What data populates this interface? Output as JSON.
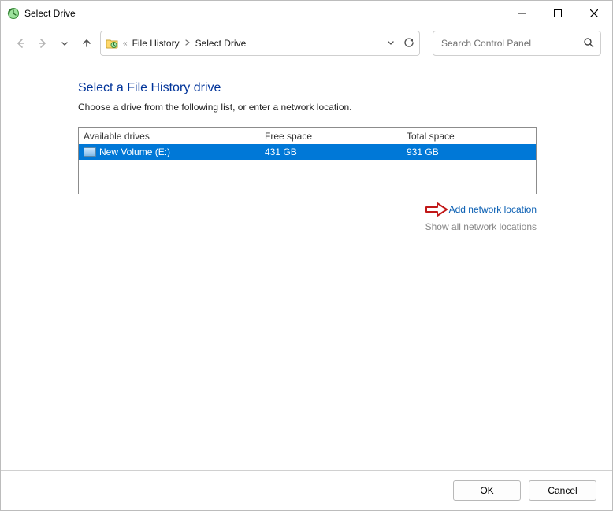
{
  "window": {
    "title": "Select Drive"
  },
  "breadcrumb": {
    "overflow_label": "«",
    "item1": "File History",
    "item2": "Select Drive"
  },
  "search": {
    "placeholder": "Search Control Panel"
  },
  "page": {
    "heading": "Select a File History drive",
    "instruction": "Choose a drive from the following list, or enter a network location."
  },
  "columns": {
    "name": "Available drives",
    "free": "Free space",
    "total": "Total space"
  },
  "drives": [
    {
      "name": "New Volume (E:)",
      "free": "431 GB",
      "total": "931 GB"
    }
  ],
  "links": {
    "add_network": "Add network location",
    "show_all": "Show all network locations"
  },
  "buttons": {
    "ok": "OK",
    "cancel": "Cancel"
  }
}
